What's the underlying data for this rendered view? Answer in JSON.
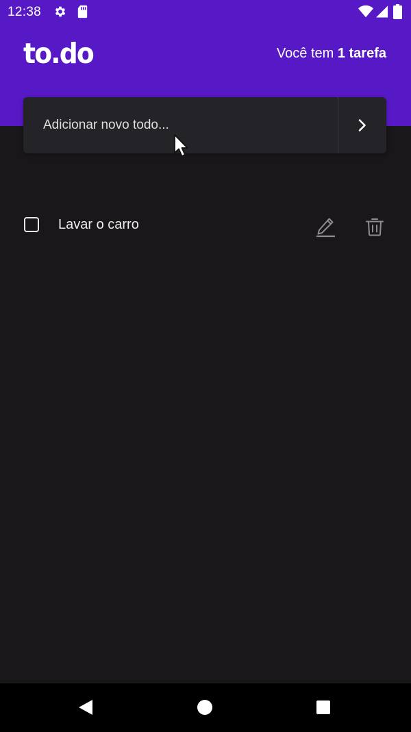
{
  "status_bar": {
    "time": "12:38",
    "icons": [
      "gear-icon",
      "sd-card-icon",
      "wifi-icon",
      "cell-signal-icon",
      "battery-icon"
    ]
  },
  "header": {
    "logo": "to.do",
    "task_counter_prefix": "Você tem ",
    "task_counter_count": "1 tarefa"
  },
  "add_todo": {
    "placeholder": "Adicionar novo todo...",
    "submit_icon": "chevron-right-icon"
  },
  "todos": [
    {
      "label": "Lavar o carro",
      "done": false,
      "edit_icon": "pencil-icon",
      "delete_icon": "trash-icon"
    }
  ],
  "colors": {
    "header_background": "#5719c6",
    "page_background": "#191719",
    "input_background": "#242327",
    "text": "#ececec"
  }
}
